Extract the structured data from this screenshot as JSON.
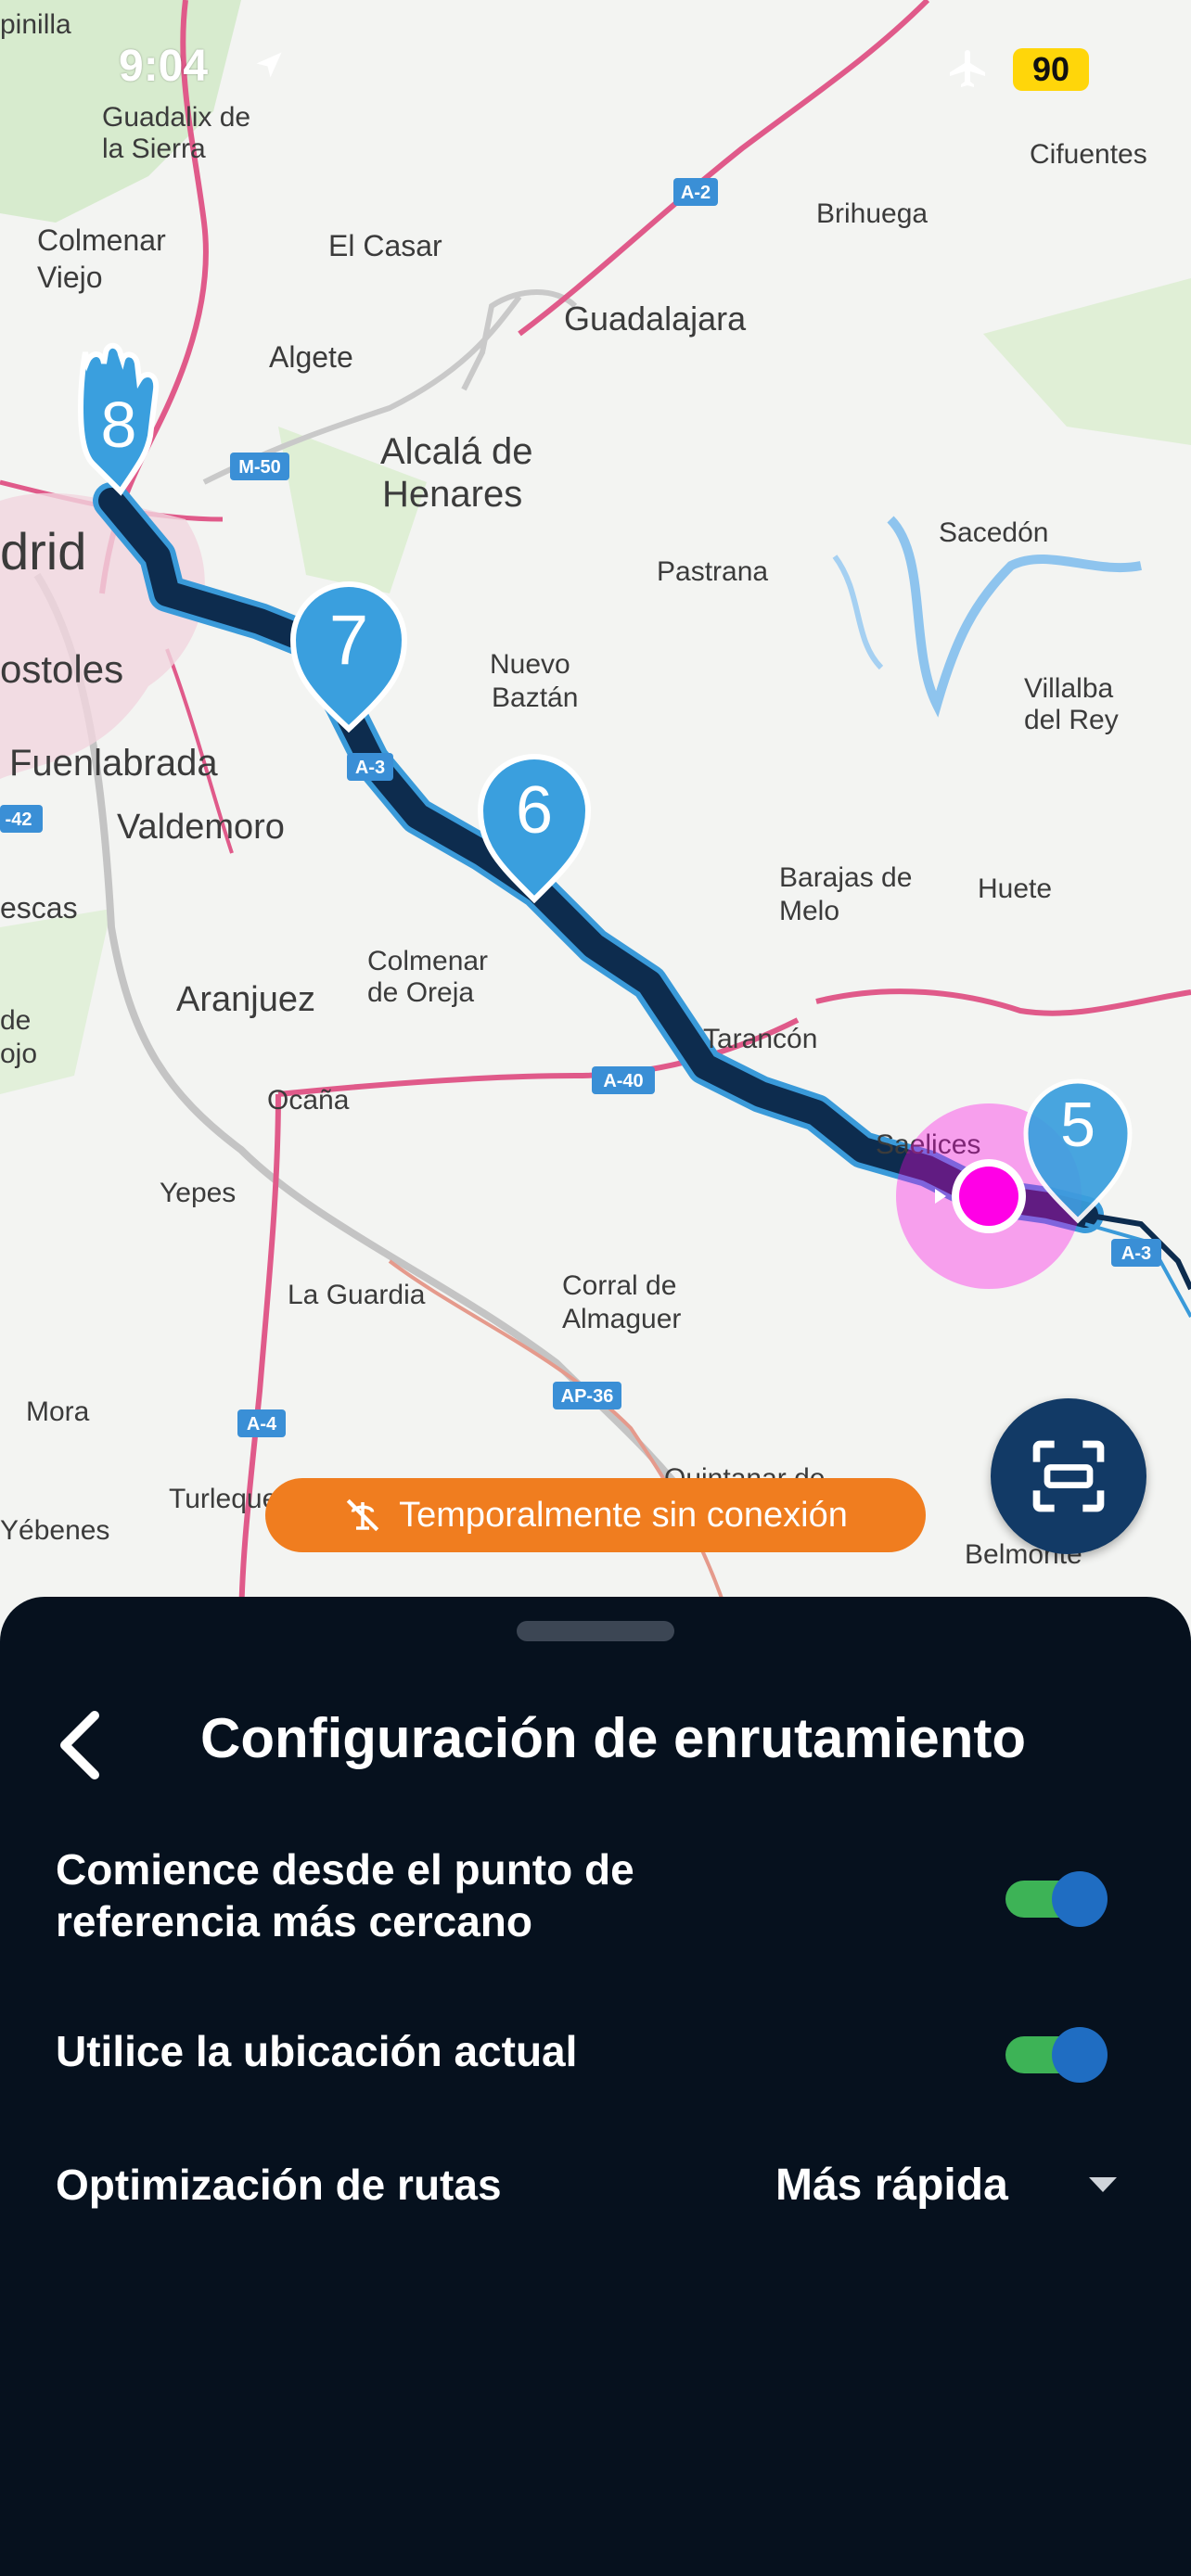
{
  "status_bar": {
    "time": "9:04",
    "battery": "90"
  },
  "map": {
    "labels": {
      "guadalix": [
        "Guadalix de",
        "la Sierra"
      ],
      "colmenar_viejo": [
        "Colmenar",
        "Viejo"
      ],
      "el_casar": "El Casar",
      "algete": "Algete",
      "guadalajara": "Guadalajara",
      "alcala": [
        "Alcalá de",
        "Henares"
      ],
      "brihuega": "Brihuega",
      "cifuentes": "Cifuentes",
      "sacedon": "Sacedón",
      "pastrana": "Pastrana",
      "madrid": "drid",
      "mostoles": "ostoles",
      "fuenlabrada": "Fuenlabrada",
      "valdemoro": "Valdemoro",
      "nuevo_baztan": [
        "Nuevo",
        "Baztán"
      ],
      "villalba": [
        "Villalba",
        "del Rey"
      ],
      "barajas": [
        "Barajas de",
        "Melo"
      ],
      "huete": "Huete",
      "escas": "escas",
      "aranjuez": "Aranjuez",
      "colmenar_oreja": [
        "Colmenar",
        "de Oreja"
      ],
      "tarancon": "Tarancón",
      "ocana": "Ocaña",
      "saelices": "Saelices",
      "yepes": "Yepes",
      "la_guardia": "La Guardia",
      "corral": [
        "Corral de",
        "Almaguer"
      ],
      "mora": "Mora",
      "turleque": "Turleque",
      "yebenes": "Yébenes",
      "quintanar": "Quintanar de",
      "belmonte": "Belmonte",
      "de_ojo": [
        "de",
        "ojo"
      ],
      "top_fragment": "pinilla"
    },
    "road_shields": {
      "a2": "A-2",
      "m50": "M-50",
      "a3_north": "A-3",
      "a40": "A-40",
      "a3_east": "A-3",
      "ap36": "AP-36",
      "a4": "A-4",
      "a42": "-42"
    },
    "waypoints": {
      "wp8": "8",
      "wp7": "7",
      "wp6": "6",
      "wp5": "5"
    },
    "colors": {
      "route": "#0d2c4e",
      "route_outline": "#3a9ad9",
      "pin": "#3a9fde",
      "current_location": "#ff00e6",
      "highway": "#e05a8a"
    }
  },
  "offline_banner": {
    "text": "Temporalmente sin conexión"
  },
  "sheet": {
    "title": "Configuración de enrutamiento",
    "settings": [
      {
        "label": "Comience desde el punto de referencia más cercano",
        "enabled": true
      },
      {
        "label": "Utilice la ubicación actual",
        "enabled": true
      }
    ],
    "optimization": {
      "label": "Optimización de rutas",
      "value": "Más rápida"
    }
  }
}
